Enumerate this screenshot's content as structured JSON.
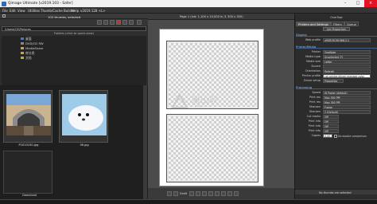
{
  "window": {
    "title": "Qimage Ultimate [v2019.103 - Safer]"
  },
  "menu": [
    "File",
    "Edit",
    "View",
    "Utilities",
    "Thumb/Cache Builder",
    "Help",
    "v2019.128 <L>"
  ],
  "left": {
    "header": "102 thumbs, selected",
    "path": "\\Users\\CS\\Pictures",
    "folders_hint": "Folders (click to quick-view)",
    "tree": [
      "桌面",
      "DVD/CD RW",
      "MediaShare",
      "库分类",
      "文档"
    ],
    "thumbs": [
      {
        "name": "P1010150.jpg"
      },
      {
        "name": "36.jpg"
      }
    ],
    "partial_thumb": "Download"
  },
  "center": {
    "page_info": "Page 1 (ind: 1,100 x 10,000 in    /1   300 x 300)",
    "watermark_text": "米山软",
    "watermark_sub": ".com",
    "zoom": "Draft"
  },
  "right": {
    "tabs": [
      "Printers and Settings",
      "Filters",
      "Queue"
    ],
    "subtab": "Job Properties",
    "overflow_label": "Overflow",
    "sections": [
      {
        "title": "Display",
        "rows": [
          {
            "label": "Web profile",
            "value": "sRGB IEC61966-2.1"
          }
        ]
      },
      {
        "title": "Printer/Media",
        "rows": [
          {
            "label": "Printer",
            "value": "OneNote"
          },
          {
            "label": "Media type",
            "value": "Unselected (?)"
          },
          {
            "label": "Media size",
            "value": "Letter"
          },
          {
            "label": "Source",
            "value": ""
          },
          {
            "label": "Orientation",
            "value": "Portrait"
          },
          {
            "label": "Printer profile",
            "value": "Let printer/driver manage color"
          },
          {
            "label": "Driver setup",
            "value": "Properties"
          }
        ]
      },
      {
        "title": "Processing",
        "rows": [
          {
            "label": "Speed",
            "value": "Hi Power (default)"
          },
          {
            "label": "Print res",
            "value": "Max 300 PPI"
          },
          {
            "label": "Print res",
            "value": "Max 300 PPI"
          },
          {
            "label": "Sharpen",
            "value": "Fusion"
          },
          {
            "label": "Sharpen",
            "value": "2 (Default)"
          },
          {
            "label": "Cut marks",
            "value": "Off"
          },
          {
            "label": "Print info",
            "value": "Off"
          },
          {
            "label": "Print info",
            "value": "Off"
          },
          {
            "label": "Print info",
            "value": "Off"
          },
          {
            "label": "Copies",
            "value": "0.00"
          }
        ]
      }
    ],
    "copies_hint": "Do double comparison",
    "queue_status": "No thumbs are selected"
  }
}
